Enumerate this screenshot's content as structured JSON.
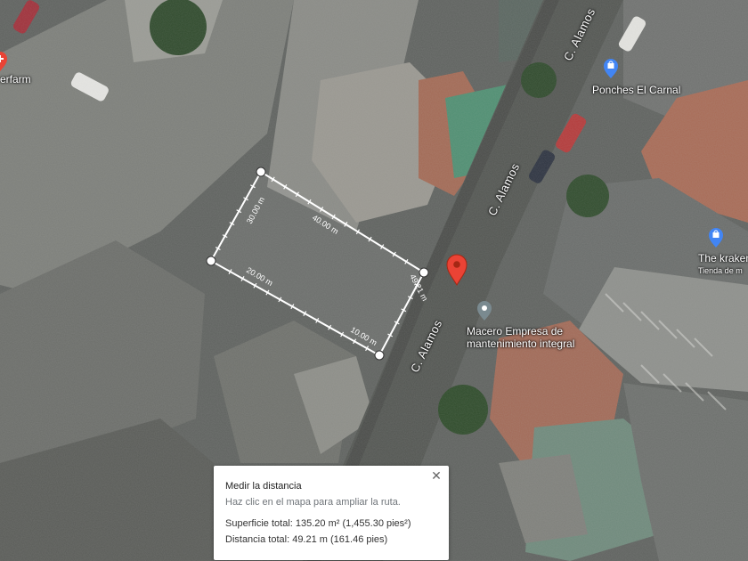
{
  "map": {
    "streets": [
      {
        "id": "c-alamos-top",
        "label": "C. Alamos"
      },
      {
        "id": "c-alamos-mid",
        "label": "C. Alamos"
      },
      {
        "id": "c-alamos-bottom",
        "label": "C. Alamos"
      }
    ],
    "places": [
      {
        "id": "ponches-el-carnal",
        "label": "Ponches El Carnal",
        "icon": "shopping-bag-icon",
        "color": "#4285f4"
      },
      {
        "id": "the-kraken",
        "label": "The kraken",
        "sublabel": "Tienda de m",
        "icon": "shopping-bag-icon",
        "color": "#4285f4"
      },
      {
        "id": "macero",
        "label": "Macero Empresa de mantenimiento integral",
        "line1": "Macero Empresa de",
        "line2": "mantenimiento integral",
        "icon": "place-icon",
        "color": "#7a8a90"
      },
      {
        "id": "erfarm",
        "label": "erfarm",
        "icon": "pharmacy-icon",
        "color": "#ea4335"
      }
    ],
    "marker_color": "#ea4335",
    "measure": {
      "segments": [
        "30.00 m",
        "40.00 m",
        "20.00 m",
        "10.00 m",
        "49.21 m"
      ]
    }
  },
  "panel": {
    "title": "Medir la distancia",
    "hint": "Haz clic en el mapa para ampliar la ruta.",
    "area": "Superficie total: 135.20 m² (1,455.30 pies²)",
    "distance": "Distancia total: 49.21 m (161.46 pies)",
    "close_label": "✕"
  }
}
